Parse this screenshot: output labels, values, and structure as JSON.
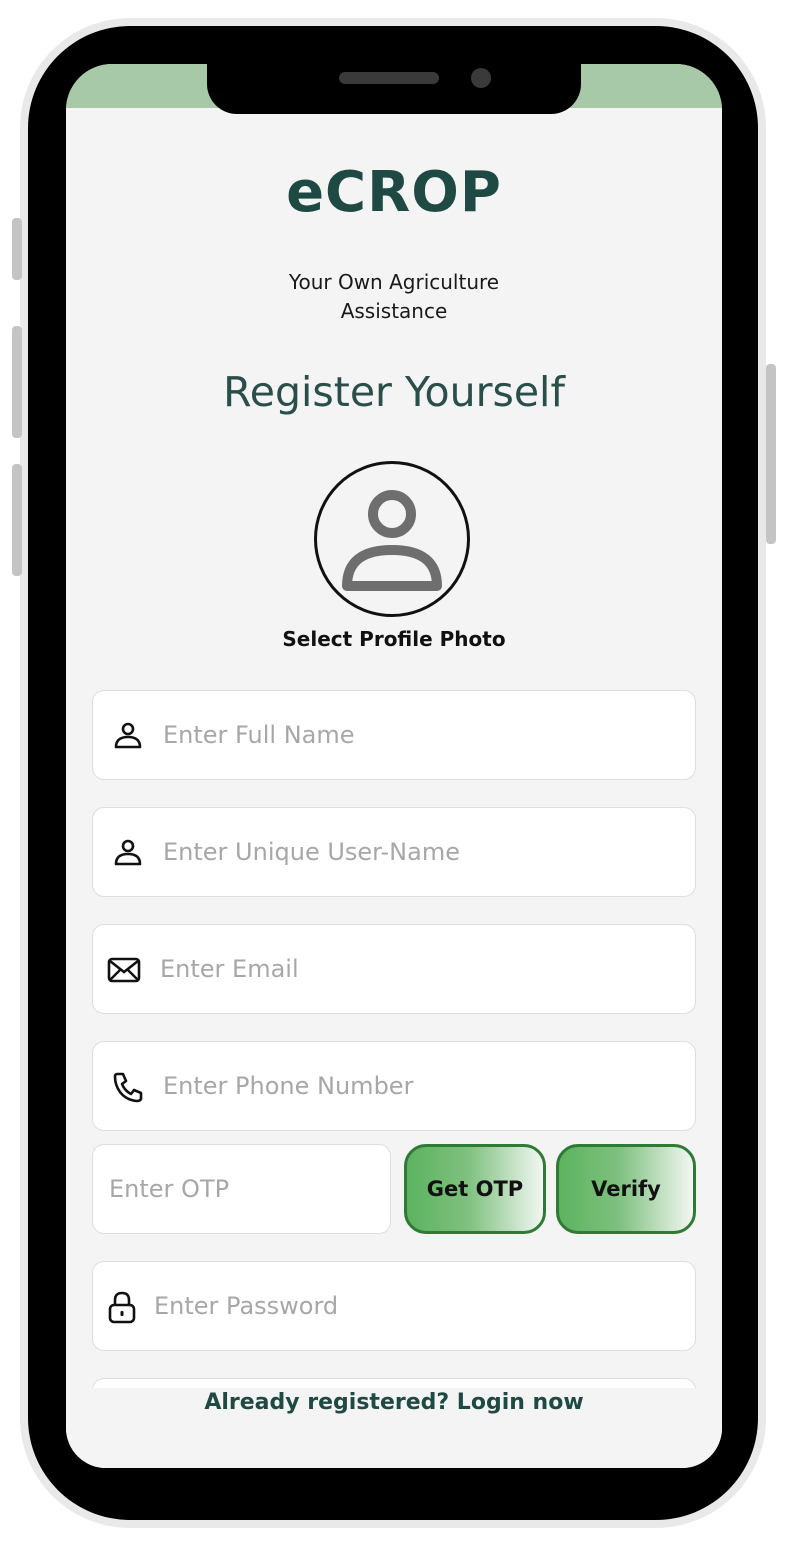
{
  "app": {
    "title": "eCROP",
    "subtitle": "Your Own Agriculture Assistance"
  },
  "page": {
    "heading": "Register Yourself"
  },
  "profile": {
    "caption": "Select Profile Photo",
    "icon": "person-icon"
  },
  "form": {
    "full_name": {
      "placeholder": "Enter Full Name",
      "icon": "person-icon"
    },
    "username": {
      "placeholder": "Enter Unique User-Name",
      "icon": "person-icon"
    },
    "email": {
      "placeholder": "Enter Email",
      "icon": "envelope-icon"
    },
    "phone": {
      "placeholder": "Enter Phone Number",
      "icon": "phone-icon"
    },
    "otp": {
      "placeholder": "Enter OTP"
    },
    "get_otp_label": "Get OTP",
    "verify_label": "Verify",
    "password": {
      "placeholder": "Enter Password",
      "icon": "lock-icon"
    }
  },
  "footer": {
    "login_link": "Already registered? Login now"
  },
  "colors": {
    "brand_dark": "#1f4a44",
    "status_strip": "#a8c9a8",
    "button_border": "#2f7a35",
    "button_green": "#5cb35f",
    "screen_bg": "#f4f4f4"
  }
}
